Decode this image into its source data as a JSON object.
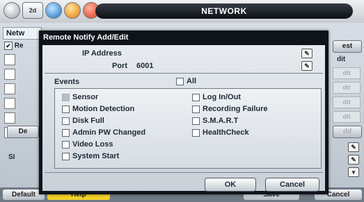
{
  "topbar": {
    "title": "NETWORK",
    "icons": [
      "camera-icon",
      "dvr-icon",
      "network-globe-icon",
      "tools-icon",
      "storage-icon"
    ],
    "dvr_label": "2d"
  },
  "background": {
    "tab_label": "Netw",
    "check_label": "Re",
    "right_header": "dit",
    "top_right_button": "est",
    "row_button": "dit",
    "left_button": "De",
    "left_button2": "dd",
    "side_label": "SI",
    "bottom": {
      "default": "Default",
      "help": "Help",
      "save": "Save",
      "cancel": "Cancel"
    }
  },
  "dialog": {
    "title": "Remote Notify Add/Edit",
    "ip_label": "IP Address",
    "ip_value": "",
    "port_label": "Port",
    "port_value": "6001",
    "events_label": "Events",
    "all_label": "All",
    "events_left": [
      {
        "label": "Sensor",
        "enabled": false
      },
      {
        "label": "Motion Detection",
        "enabled": true
      },
      {
        "label": "Disk Full",
        "enabled": true
      },
      {
        "label": "Admin PW Changed",
        "enabled": true
      },
      {
        "label": "Video Loss",
        "enabled": true
      },
      {
        "label": "System Start",
        "enabled": true
      }
    ],
    "events_right": [
      {
        "label": "Log In/Out",
        "enabled": true
      },
      {
        "label": "Recording Failure",
        "enabled": true
      },
      {
        "label": "S.M.A.R.T",
        "enabled": true
      },
      {
        "label": "HealthCheck",
        "enabled": true
      }
    ],
    "ok_label": "OK",
    "cancel_label": "Cancel"
  }
}
